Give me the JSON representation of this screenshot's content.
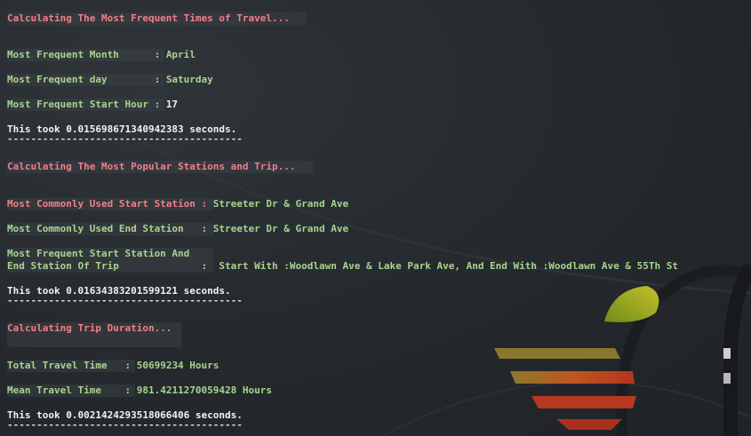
{
  "colors": {
    "heading": "#f07f8a",
    "label": "#a8d48e",
    "value_text": "#f2f2f2",
    "background": "#272b30"
  },
  "section1": {
    "heading": "Calculating The Most Frequent Times of Travel...",
    "month_label": "Most Frequent Month      : ",
    "month_value": "April",
    "day_label": "Most Frequent day        : ",
    "day_value": "Saturday",
    "hour_label": "Most Frequent Start Hour : ",
    "hour_value": "17",
    "timing": "This took 0.015698671340942383 seconds.",
    "separator": "----------------------------------------"
  },
  "section2": {
    "heading": "Calculating The Most Popular Stations and Trip...",
    "start_label": "Most Commonly Used Start Station : ",
    "start_value": "Streeter Dr & Grand Ave",
    "end_label": "Most Commonly Used End Station   : ",
    "end_value": "Streeter Dr & Grand Ave",
    "trip_label_1": "Most Frequent Start Station And",
    "trip_label_2": "End Station Of Trip              :  ",
    "trip_value": "Start With :Woodlawn Ave & Lake Park Ave, And End With :Woodlawn Ave & 55Th St",
    "timing": "This took 0.01634383201599121 seconds.",
    "separator": "----------------------------------------"
  },
  "section3": {
    "heading": "Calculating Trip Duration...",
    "total_label": "Total Travel Time   : ",
    "total_value": "50699234 Hours",
    "mean_label": "Mean Travel Time    : ",
    "mean_value": "981.4211270059428 Hours",
    "timing": "This took 0.0021424293518066406 seconds.",
    "separator": "----------------------------------------"
  }
}
